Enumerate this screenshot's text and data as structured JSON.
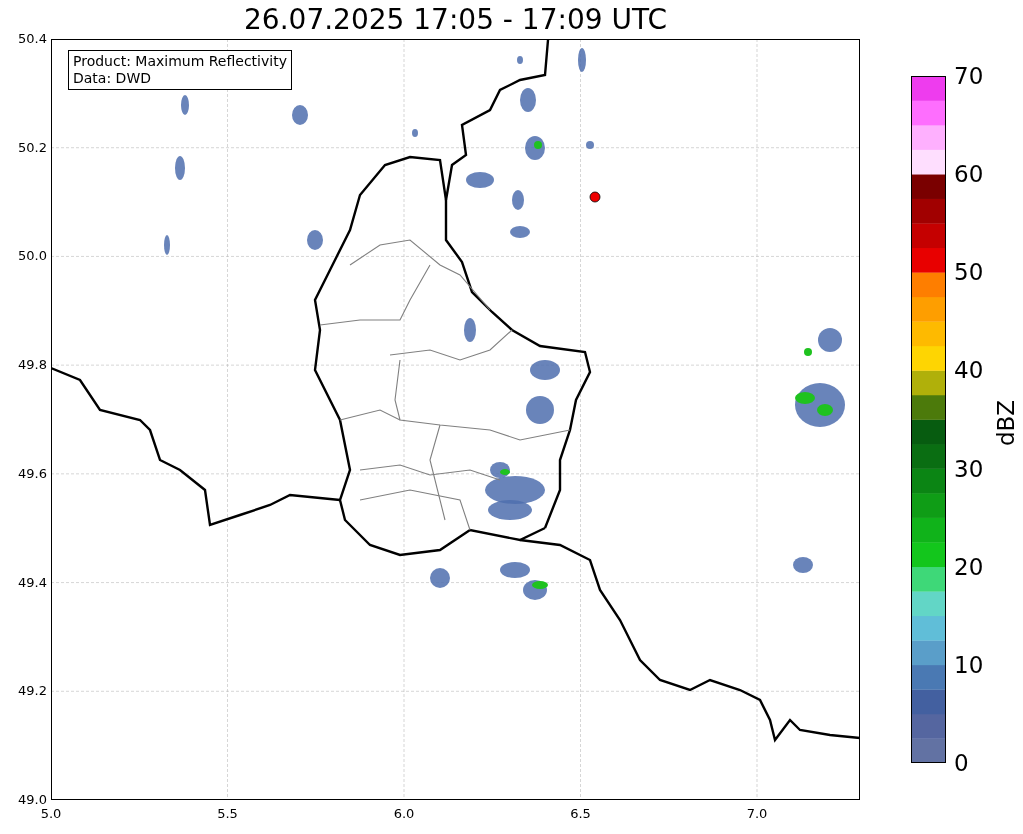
{
  "title": "26.07.2025 17:05 - 17:09 UTC",
  "info_box": {
    "lines": [
      "Product: Maximum Reflectivity",
      "Data: DWD"
    ]
  },
  "x_ticks": [
    "5.0",
    "5.5",
    "6.0",
    "6.5",
    "7.0"
  ],
  "y_ticks": [
    "50.4",
    "50.2",
    "50.0",
    "49.8",
    "49.6",
    "49.4",
    "49.2",
    "49.0"
  ],
  "colorbar": {
    "label": "dBZ",
    "ticks": [
      "70",
      "60",
      "50",
      "40",
      "30",
      "20",
      "10",
      "0"
    ],
    "bands": [
      {
        "color": "#6272a3"
      },
      {
        "color": "#5566a0"
      },
      {
        "color": "#4360a0"
      },
      {
        "color": "#4a79b3"
      },
      {
        "color": "#5a9ec9"
      },
      {
        "color": "#60bed8"
      },
      {
        "color": "#62d6c6"
      },
      {
        "color": "#3ed878"
      },
      {
        "color": "#13c61c"
      },
      {
        "color": "#10b31a"
      },
      {
        "color": "#0f9d16"
      },
      {
        "color": "#0b8514"
      },
      {
        "color": "#0a6e12"
      },
      {
        "color": "#075c10"
      },
      {
        "color": "#4c7a0b"
      },
      {
        "color": "#b0b00a"
      },
      {
        "color": "#fed502"
      },
      {
        "color": "#feba00"
      },
      {
        "color": "#fe9e00"
      },
      {
        "color": "#fe7e00"
      },
      {
        "color": "#e80000"
      },
      {
        "color": "#c50000"
      },
      {
        "color": "#a10000"
      },
      {
        "color": "#7a0000"
      },
      {
        "color": "#fedefe"
      },
      {
        "color": "#feb0fe"
      },
      {
        "color": "#fe6efe"
      },
      {
        "color": "#ee3cee"
      }
    ]
  }
}
